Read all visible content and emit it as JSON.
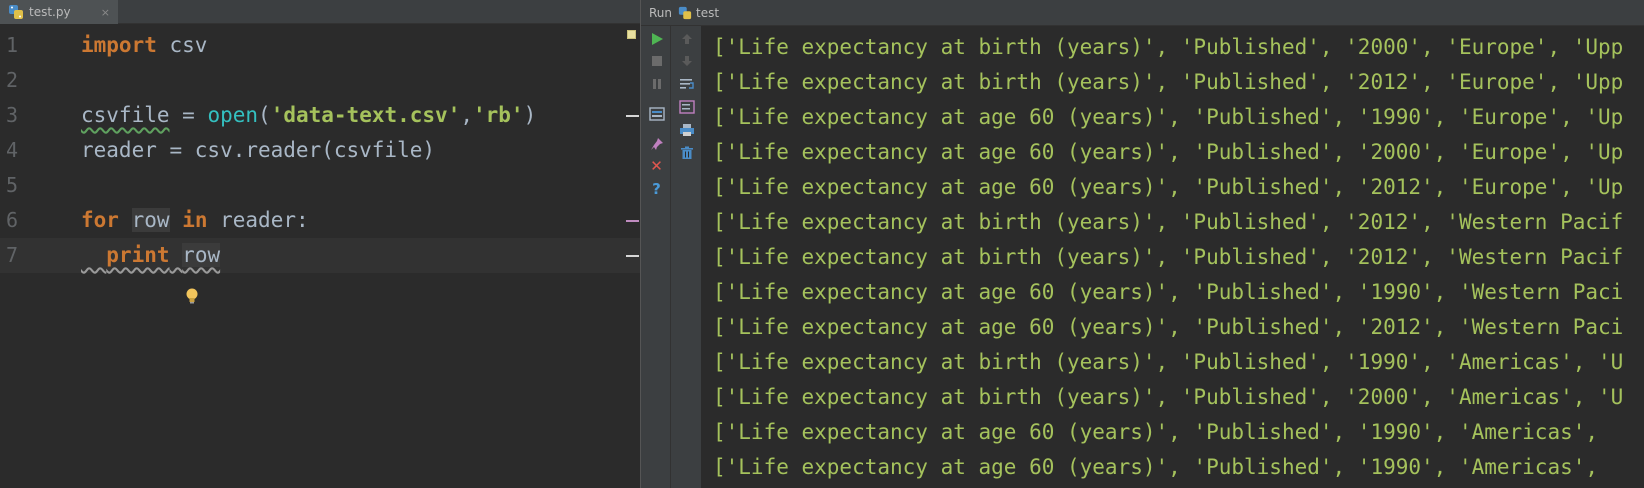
{
  "editor": {
    "tab_label": "test.py",
    "tab_close": "×",
    "lines": [
      {
        "num": "1"
      },
      {
        "num": "2"
      },
      {
        "num": "3"
      },
      {
        "num": "4"
      },
      {
        "num": "5"
      },
      {
        "num": "6"
      },
      {
        "num": "7"
      }
    ],
    "code": {
      "l1_kw": "import",
      "l1_mod": " csv",
      "l3_var": "csvfile",
      "l3_eq": " = ",
      "l3_fn": "open",
      "l3_p1": "(",
      "l3_s1": "'data-text.csv'",
      "l3_comma": ",",
      "l3_s2": "'rb'",
      "l3_p2": ")",
      "l4_text": "reader = csv.reader(csvfile)",
      "l6_kw1": "for",
      "l6_row": "row",
      "l6_kw2": "in",
      "l6_rest": " reader:",
      "l7_kw": "print",
      "l7_row": "row"
    }
  },
  "run": {
    "label": "Run",
    "config_name": "test",
    "output_lines": [
      "['Life expectancy at birth (years)', 'Published', '2000', 'Europe', 'Upp",
      "['Life expectancy at birth (years)', 'Published', '2012', 'Europe', 'Upp",
      "['Life expectancy at age 60 (years)', 'Published', '1990', 'Europe', 'Up",
      "['Life expectancy at age 60 (years)', 'Published', '2000', 'Europe', 'Up",
      "['Life expectancy at age 60 (years)', 'Published', '2012', 'Europe', 'Up",
      "['Life expectancy at birth (years)', 'Published', '2012', 'Western Pacif",
      "['Life expectancy at birth (years)', 'Published', '2012', 'Western Pacif",
      "['Life expectancy at age 60 (years)', 'Published', '1990', 'Western Paci",
      "['Life expectancy at age 60 (years)', 'Published', '2012', 'Western Paci",
      "['Life expectancy at birth (years)', 'Published', '1990', 'Americas', 'U",
      "['Life expectancy at birth (years)', 'Published', '2000', 'Americas', 'U",
      "['Life expectancy at age 60 (years)', 'Published', '1990', 'Americas', ",
      "['Life expectancy at age 60 (years)', 'Published', '1990', 'Americas', "
    ]
  },
  "icons": {
    "rerun": "play-icon",
    "stop": "stop-icon",
    "pause": "pause-icon",
    "up": "arrow-up-icon",
    "down": "arrow-down-icon",
    "help": "help-icon",
    "close": "close-icon"
  },
  "help_glyph": "?",
  "close_glyph": "✕",
  "colors": {
    "keyword": "#cc7832",
    "string": "#a5c25c",
    "builtin": "#34c0c0",
    "text": "#a9b7c6",
    "output": "#a5c25c",
    "background": "#2b2b2b"
  }
}
